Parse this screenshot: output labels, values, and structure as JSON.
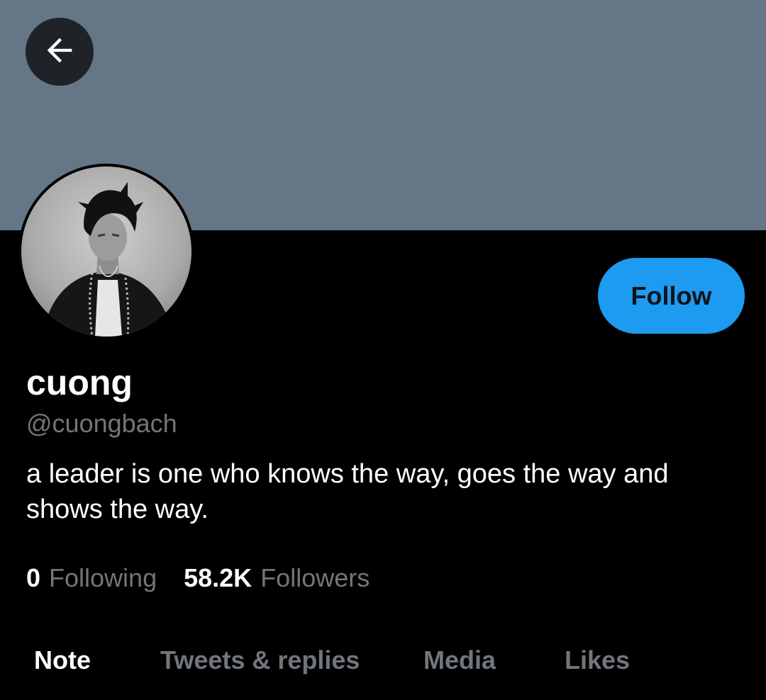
{
  "header": {
    "back_icon": "arrow-left-icon",
    "banner_color": "#657786"
  },
  "profile": {
    "display_name": "cuong",
    "handle": "@cuongbach",
    "bio": "a leader is one who knows the way, goes the way and shows the way.",
    "follow_label": "Follow",
    "avatar": "profile-photo"
  },
  "stats": {
    "following_count": "0",
    "following_label": "Following",
    "followers_count": "58.2K",
    "followers_label": "Followers"
  },
  "tabs": [
    {
      "label": "Note",
      "active": true
    },
    {
      "label": "Tweets & replies",
      "active": false
    },
    {
      "label": "Media",
      "active": false
    },
    {
      "label": "Likes",
      "active": false
    }
  ],
  "colors": {
    "accent": "#1d9bf0",
    "background": "#000000",
    "secondary_text": "#71767b"
  }
}
